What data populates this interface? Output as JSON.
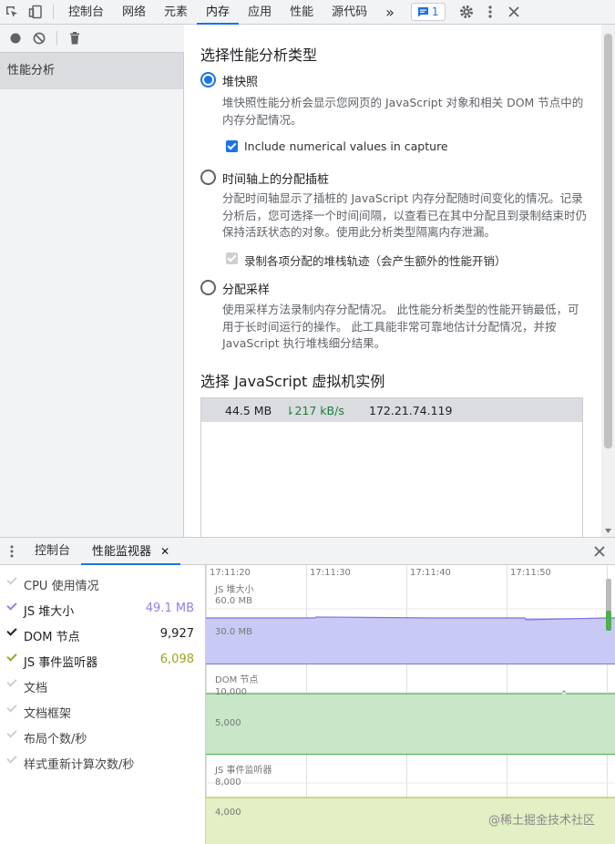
{
  "topbar": {
    "tabs": [
      "控制台",
      "网络",
      "元素",
      "内存",
      "应用",
      "性能",
      "源代码"
    ],
    "active_tab": "内存",
    "more": "»",
    "issues_count": "1"
  },
  "sidebar": {
    "item": "性能分析"
  },
  "main": {
    "heading": "选择性能分析类型",
    "options": [
      {
        "label": "堆快照",
        "desc": "堆快照性能分析会显示您网页的 JavaScript 对象和相关 DOM 节点中的内存分配情况。",
        "checkbox": "Include numerical values in capture"
      },
      {
        "label": "时间轴上的分配插桩",
        "desc": "分配时间轴显示了插桩的 JavaScript 内存分配随时间变化的情况。记录分析后，您可选择一个时间间隔，以查看已在其中分配且到录制结束时仍保持活跃状态的对象。使用此分析类型隔离内存泄漏。",
        "checkbox": "录制各项分配的堆栈轨迹（会产生额外的性能开销）"
      },
      {
        "label": "分配采样",
        "desc": "使用采样方法录制内存分配情况。 此性能分析类型的性能开销最低，可用于长时间运行的操作。 此工具能非常可靠地估计分配情况，并按 JavaScript 执行堆栈细分结果。"
      }
    ],
    "vm_heading": "选择 JavaScript 虚拟机实例",
    "vm": {
      "size": "44.5 MB",
      "rate": "⇂217 kB/s",
      "host": "172.21.74.119"
    }
  },
  "drawer": {
    "tabs": [
      "控制台",
      "性能监视器"
    ],
    "close_tab": "✕"
  },
  "metrics": [
    {
      "label": "CPU 使用情况",
      "value": "",
      "checked": false
    },
    {
      "label": "JS 堆大小",
      "value": "49.1 MB",
      "checked": true,
      "color": "#8c84e8"
    },
    {
      "label": "DOM 节点",
      "value": "9,927",
      "checked": true,
      "color": "#202124"
    },
    {
      "label": "JS 事件监听器",
      "value": "6,098",
      "checked": true,
      "color": "#9aa71e"
    },
    {
      "label": "文档",
      "value": "",
      "checked": false
    },
    {
      "label": "文档框架",
      "value": "",
      "checked": false
    },
    {
      "label": "布局个数/秒",
      "value": "",
      "checked": false
    },
    {
      "label": "样式重新计算次数/秒",
      "value": "",
      "checked": false
    }
  ],
  "monitor": {
    "times": [
      "17:11:20",
      "17:11:30",
      "17:11:40",
      "17:11:50"
    ],
    "heap": {
      "title": "JS 堆大小",
      "tick_high": "60.0 MB",
      "tick_low": "30.0 MB",
      "color": "#c9c9f5"
    },
    "dom": {
      "title": "DOM 节点",
      "tick_high": "10,000",
      "tick_low": "5,000",
      "color": "#c8e7c8"
    },
    "listeners": {
      "title": "JS 事件监听器",
      "tick_high": "8,000",
      "tick_low": "4,000",
      "color": "#e3efc4"
    }
  },
  "watermark": "@稀土掘金技术社区"
}
